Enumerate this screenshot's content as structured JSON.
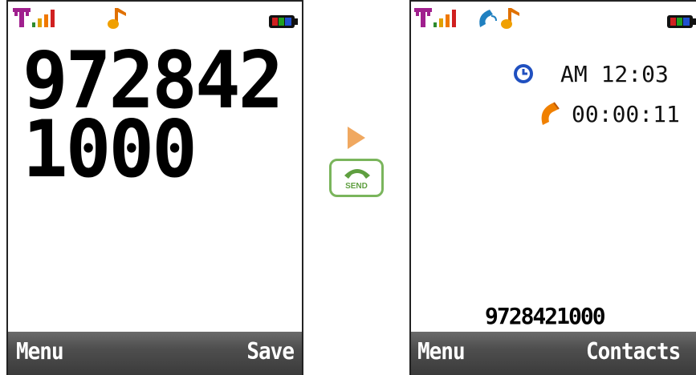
{
  "left_screen": {
    "dialed_number": "9728421000",
    "softkeys": {
      "left": "Menu",
      "right": "Save"
    },
    "status_icons": [
      "signal-antenna-icon",
      "signal-bars-icon",
      "music-note-icon",
      "battery-icon"
    ]
  },
  "transition": {
    "arrow_icon": "play-arrow-icon",
    "send_key": {
      "label": "SEND",
      "icon": "phone-handset-icon"
    }
  },
  "right_screen": {
    "clock": {
      "icon": "clock-icon",
      "value": "AM 12:03"
    },
    "call_timer": {
      "icon": "phone-handset-icon",
      "value": "00:00:11"
    },
    "called_number": "9728421000",
    "softkeys": {
      "left": "Menu",
      "right": "Contacts"
    },
    "status_icons": [
      "signal-antenna-icon",
      "signal-bars-icon",
      "call-active-icon",
      "music-note-icon",
      "battery-icon"
    ]
  },
  "colors": {
    "softkey_bar": "#4e4e4e",
    "antenna": "#a0208e",
    "signal_bars": [
      "#2e8b2e",
      "#e0a000",
      "#f07800",
      "#d02020"
    ],
    "arrow": "#f0a860",
    "send_key_border": "#7ab55c",
    "handset_orange": "#f08000",
    "clock_blue": "#2050c0"
  }
}
